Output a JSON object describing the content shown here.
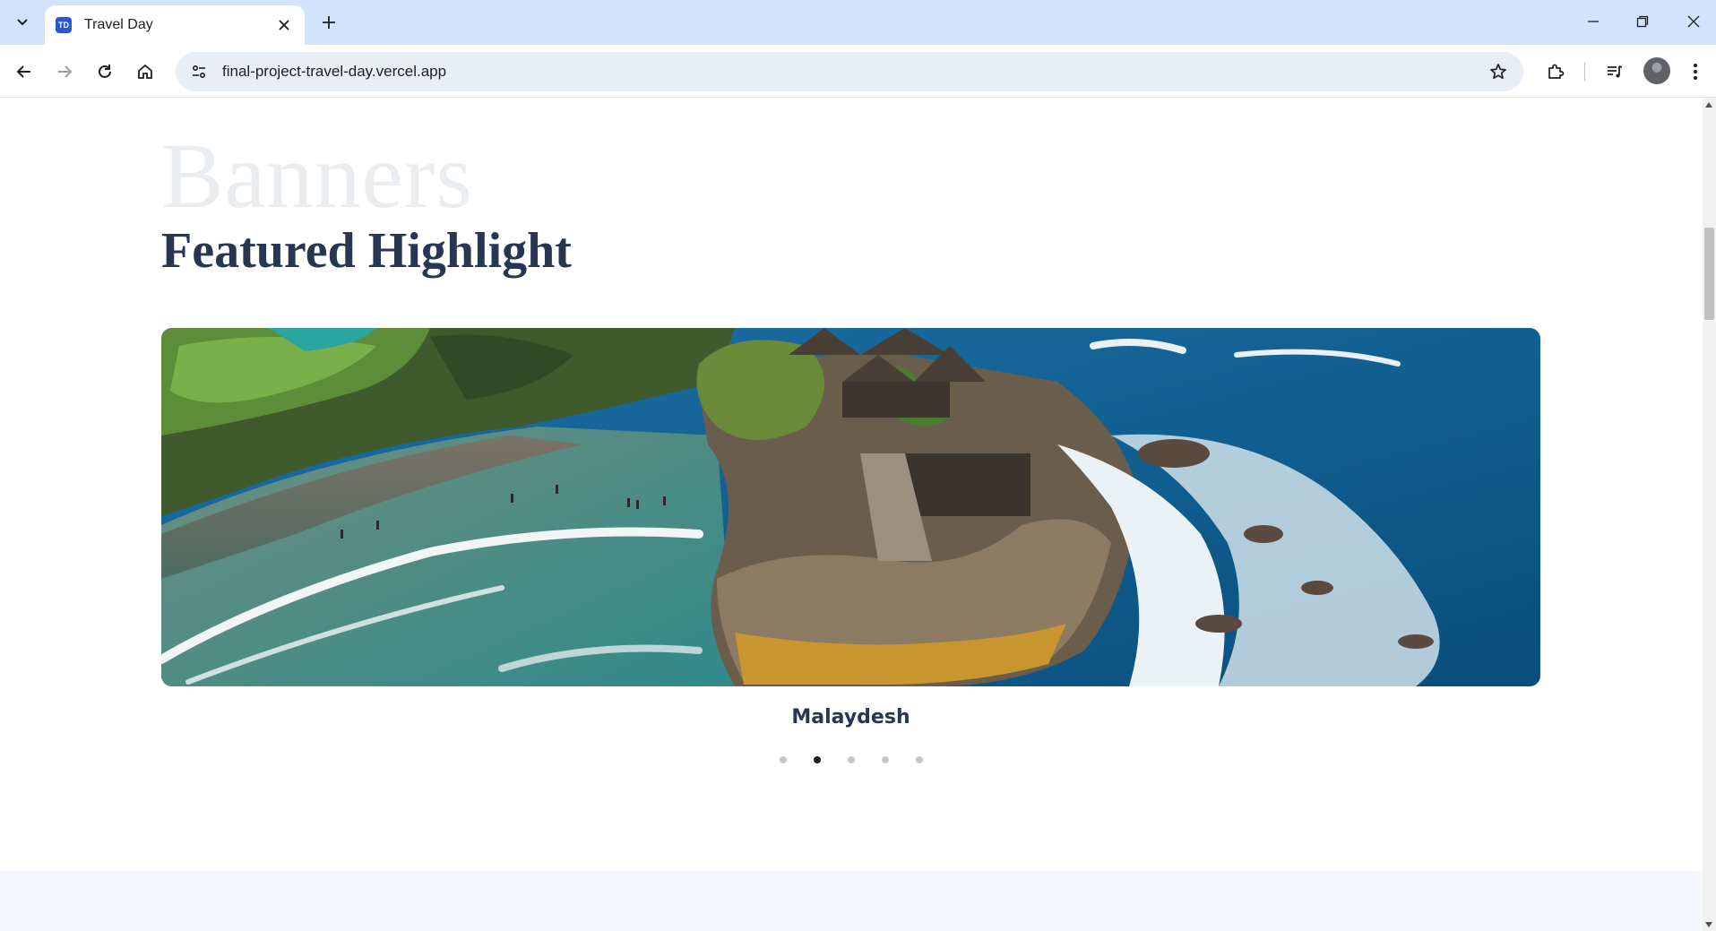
{
  "browser": {
    "tab_title": "Travel Day",
    "favicon_text": "TD",
    "url": "final-project-travel-day.vercel.app"
  },
  "page": {
    "background_title": "Banners",
    "section_title": "Featured Highlight",
    "slider": {
      "caption": "Malaydesh",
      "dot_count": 5,
      "active_index": 1
    }
  },
  "colors": {
    "title": "#263653",
    "background_title": "#eaedf0",
    "tabstrip": "#d3e3fd",
    "next_section": "#f5f7fe"
  },
  "icons": {
    "tab_search": "chevron-down-icon",
    "tab_close": "close-icon",
    "new_tab": "plus-icon",
    "back": "arrow-left-icon",
    "forward": "arrow-right-icon",
    "reload": "reload-icon",
    "home": "home-icon",
    "site_info": "tune-icon",
    "bookmark": "star-icon",
    "extensions": "puzzle-icon",
    "media": "media-queue-icon",
    "menu": "kebab-menu-icon"
  }
}
